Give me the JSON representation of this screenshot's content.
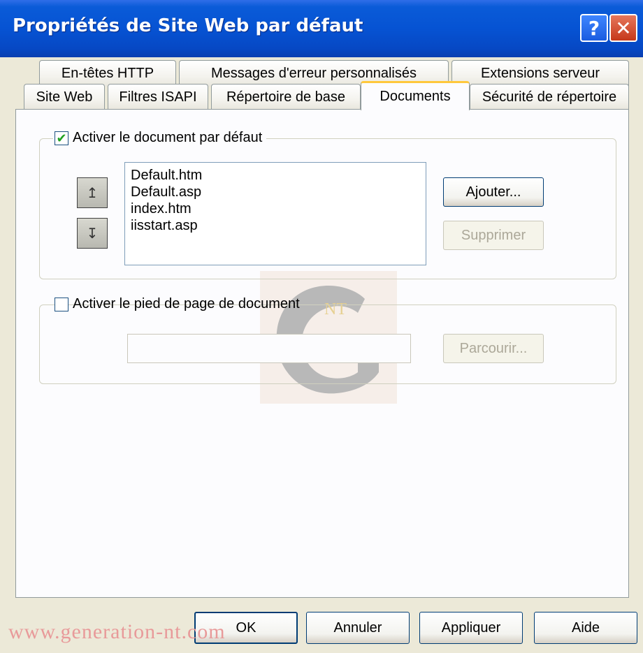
{
  "window": {
    "title": "Propriétés de Site Web par défaut",
    "help_glyph": "?",
    "close_glyph": "✕"
  },
  "tabs_row1": [
    {
      "label": "En-têtes HTTP"
    },
    {
      "label": "Messages d'erreur personnalisés"
    },
    {
      "label": "Extensions serveur"
    }
  ],
  "tabs_row2": [
    {
      "label": "Site Web"
    },
    {
      "label": "Filtres ISAPI"
    },
    {
      "label": "Répertoire de base"
    },
    {
      "label": "Documents",
      "active": true
    },
    {
      "label": "Sécurité de répertoire"
    }
  ],
  "default_doc": {
    "checkbox_label": "Activer le document par défaut",
    "checked": true,
    "check_glyph": "✔",
    "files": [
      "Default.htm",
      "Default.asp",
      "index.htm",
      "iisstart.asp"
    ],
    "move_up_glyph": "↥",
    "move_down_glyph": "↧",
    "add_label": "Ajouter...",
    "remove_label": "Supprimer"
  },
  "footer_doc": {
    "checkbox_label": "Activer le pied de page de document",
    "checked": false,
    "path_value": "",
    "browse_label": "Parcourir..."
  },
  "buttons": {
    "ok": "OK",
    "cancel": "Annuler",
    "apply": "Appliquer",
    "help": "Aide"
  },
  "watermark": {
    "logo_text": "NT",
    "site_text": "www.generation-nt.com"
  },
  "colors": {
    "titlebar": "#0653d3",
    "active_tab_accent": "#ffc83c",
    "dialog_bg": "#ece9d8"
  }
}
